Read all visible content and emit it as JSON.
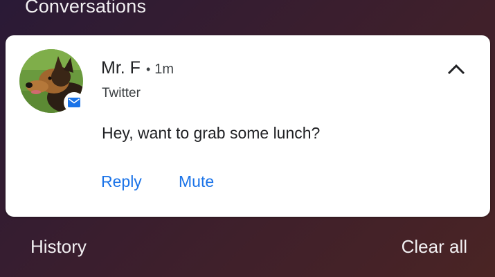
{
  "section": {
    "title": "Conversations"
  },
  "notification": {
    "sender": "Mr. F",
    "separator": "•",
    "time": "1m",
    "app_name": "Twitter",
    "message": "Hey, want to grab some lunch?",
    "avatar_icon": "dog-avatar",
    "app_icon": "mail-icon",
    "expand_icon": "chevron-up-icon",
    "actions": [
      {
        "label": "Reply"
      },
      {
        "label": "Mute"
      }
    ]
  },
  "footer": {
    "history_label": "History",
    "clear_all_label": "Clear all"
  },
  "colors": {
    "accent": "#1a73e8",
    "card_bg": "#ffffff",
    "shade_bg_start": "#2a1a36",
    "shade_bg_end": "#4a2424"
  }
}
